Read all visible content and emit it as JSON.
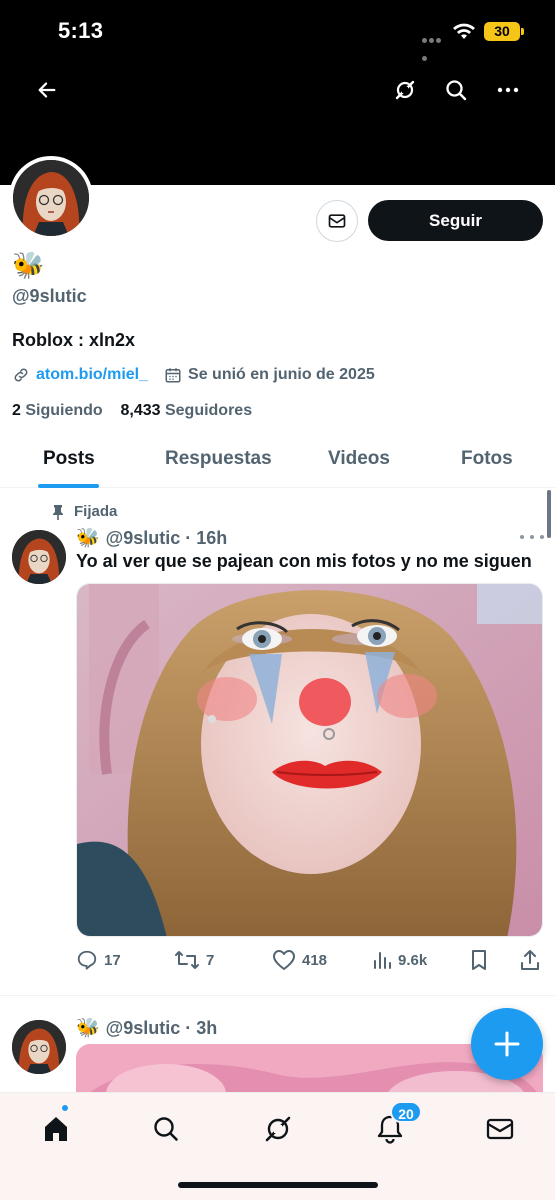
{
  "status_bar": {
    "time": "5:13",
    "battery": "30"
  },
  "profile": {
    "display_name": "🐝",
    "handle": "@9slutic",
    "bio": "Roblox : xln2x",
    "link": "atom.bio/miel_",
    "joined": "Se unió en junio de 2025",
    "following_count": "2",
    "following_label": "Siguiendo",
    "followers_count": "8,433",
    "followers_label": "Seguidores",
    "follow_button": "Seguir"
  },
  "tabs": [
    {
      "label": "Posts",
      "active": true
    },
    {
      "label": "Respuestas",
      "active": false
    },
    {
      "label": "Videos",
      "active": false
    },
    {
      "label": "Fotos",
      "active": false
    }
  ],
  "posts": [
    {
      "pinned_label": "Fijada",
      "emoji": "🐝",
      "handle": "@9slutic",
      "time": "16h",
      "text": "Yo al ver que se pajean con mis fotos y no me siguen",
      "replies": "17",
      "reposts": "7",
      "likes": "418",
      "views": "9.6k"
    },
    {
      "emoji": "🐝",
      "handle": "@9slutic",
      "time": "3h"
    }
  ],
  "bottom_nav": {
    "notifications_badge": "20"
  },
  "colors": {
    "accent": "#1d9bf0",
    "text": "#0f1419",
    "muted": "#536471"
  }
}
